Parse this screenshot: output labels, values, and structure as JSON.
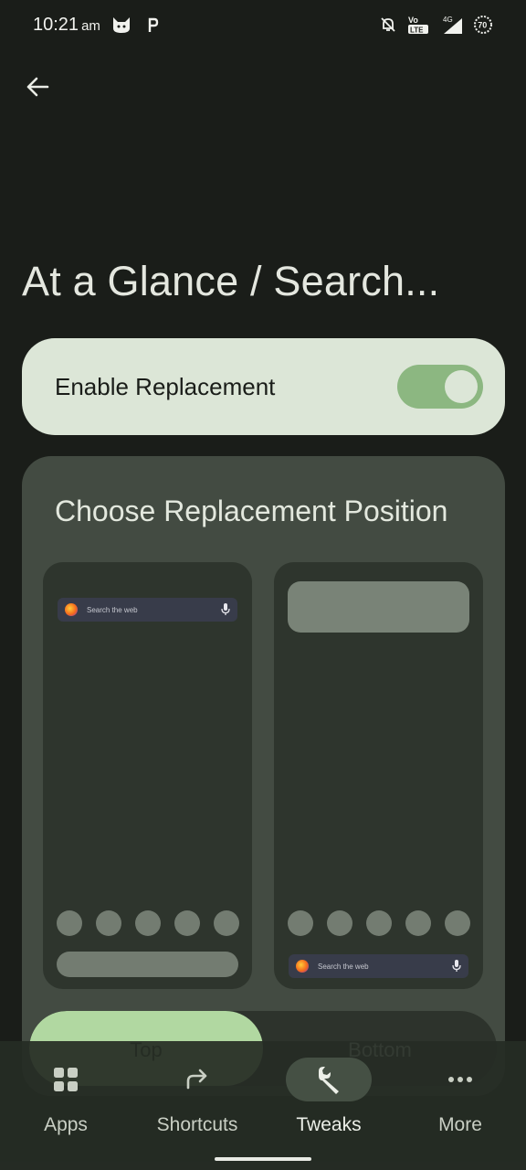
{
  "status": {
    "time": "10:21",
    "ampm": "am",
    "network": "4G",
    "volte": "Vo LTE",
    "battery": "70"
  },
  "header": {
    "back_icon": "arrow-left-icon",
    "title": "At a Glance / Search..."
  },
  "enable": {
    "label": "Enable Replacement",
    "enabled": true
  },
  "position": {
    "title": "Choose Replacement Position",
    "preview_search_text": "Search the web",
    "options": [
      "Top",
      "Bottom"
    ],
    "selected": "Top"
  },
  "nav": {
    "items": [
      {
        "label": "Apps",
        "icon": "grid-icon"
      },
      {
        "label": "Shortcuts",
        "icon": "shortcut-arrow-icon"
      },
      {
        "label": "Tweaks",
        "icon": "wrench-icon"
      },
      {
        "label": "More",
        "icon": "more-dots-icon"
      }
    ],
    "active": "Tweaks"
  },
  "colors": {
    "background": "#1a1d19",
    "enable_card": "#dce6d7",
    "toggle_on": "#8cb781",
    "position_card": "#434b42",
    "selected_segment": "#b1d8a1"
  }
}
